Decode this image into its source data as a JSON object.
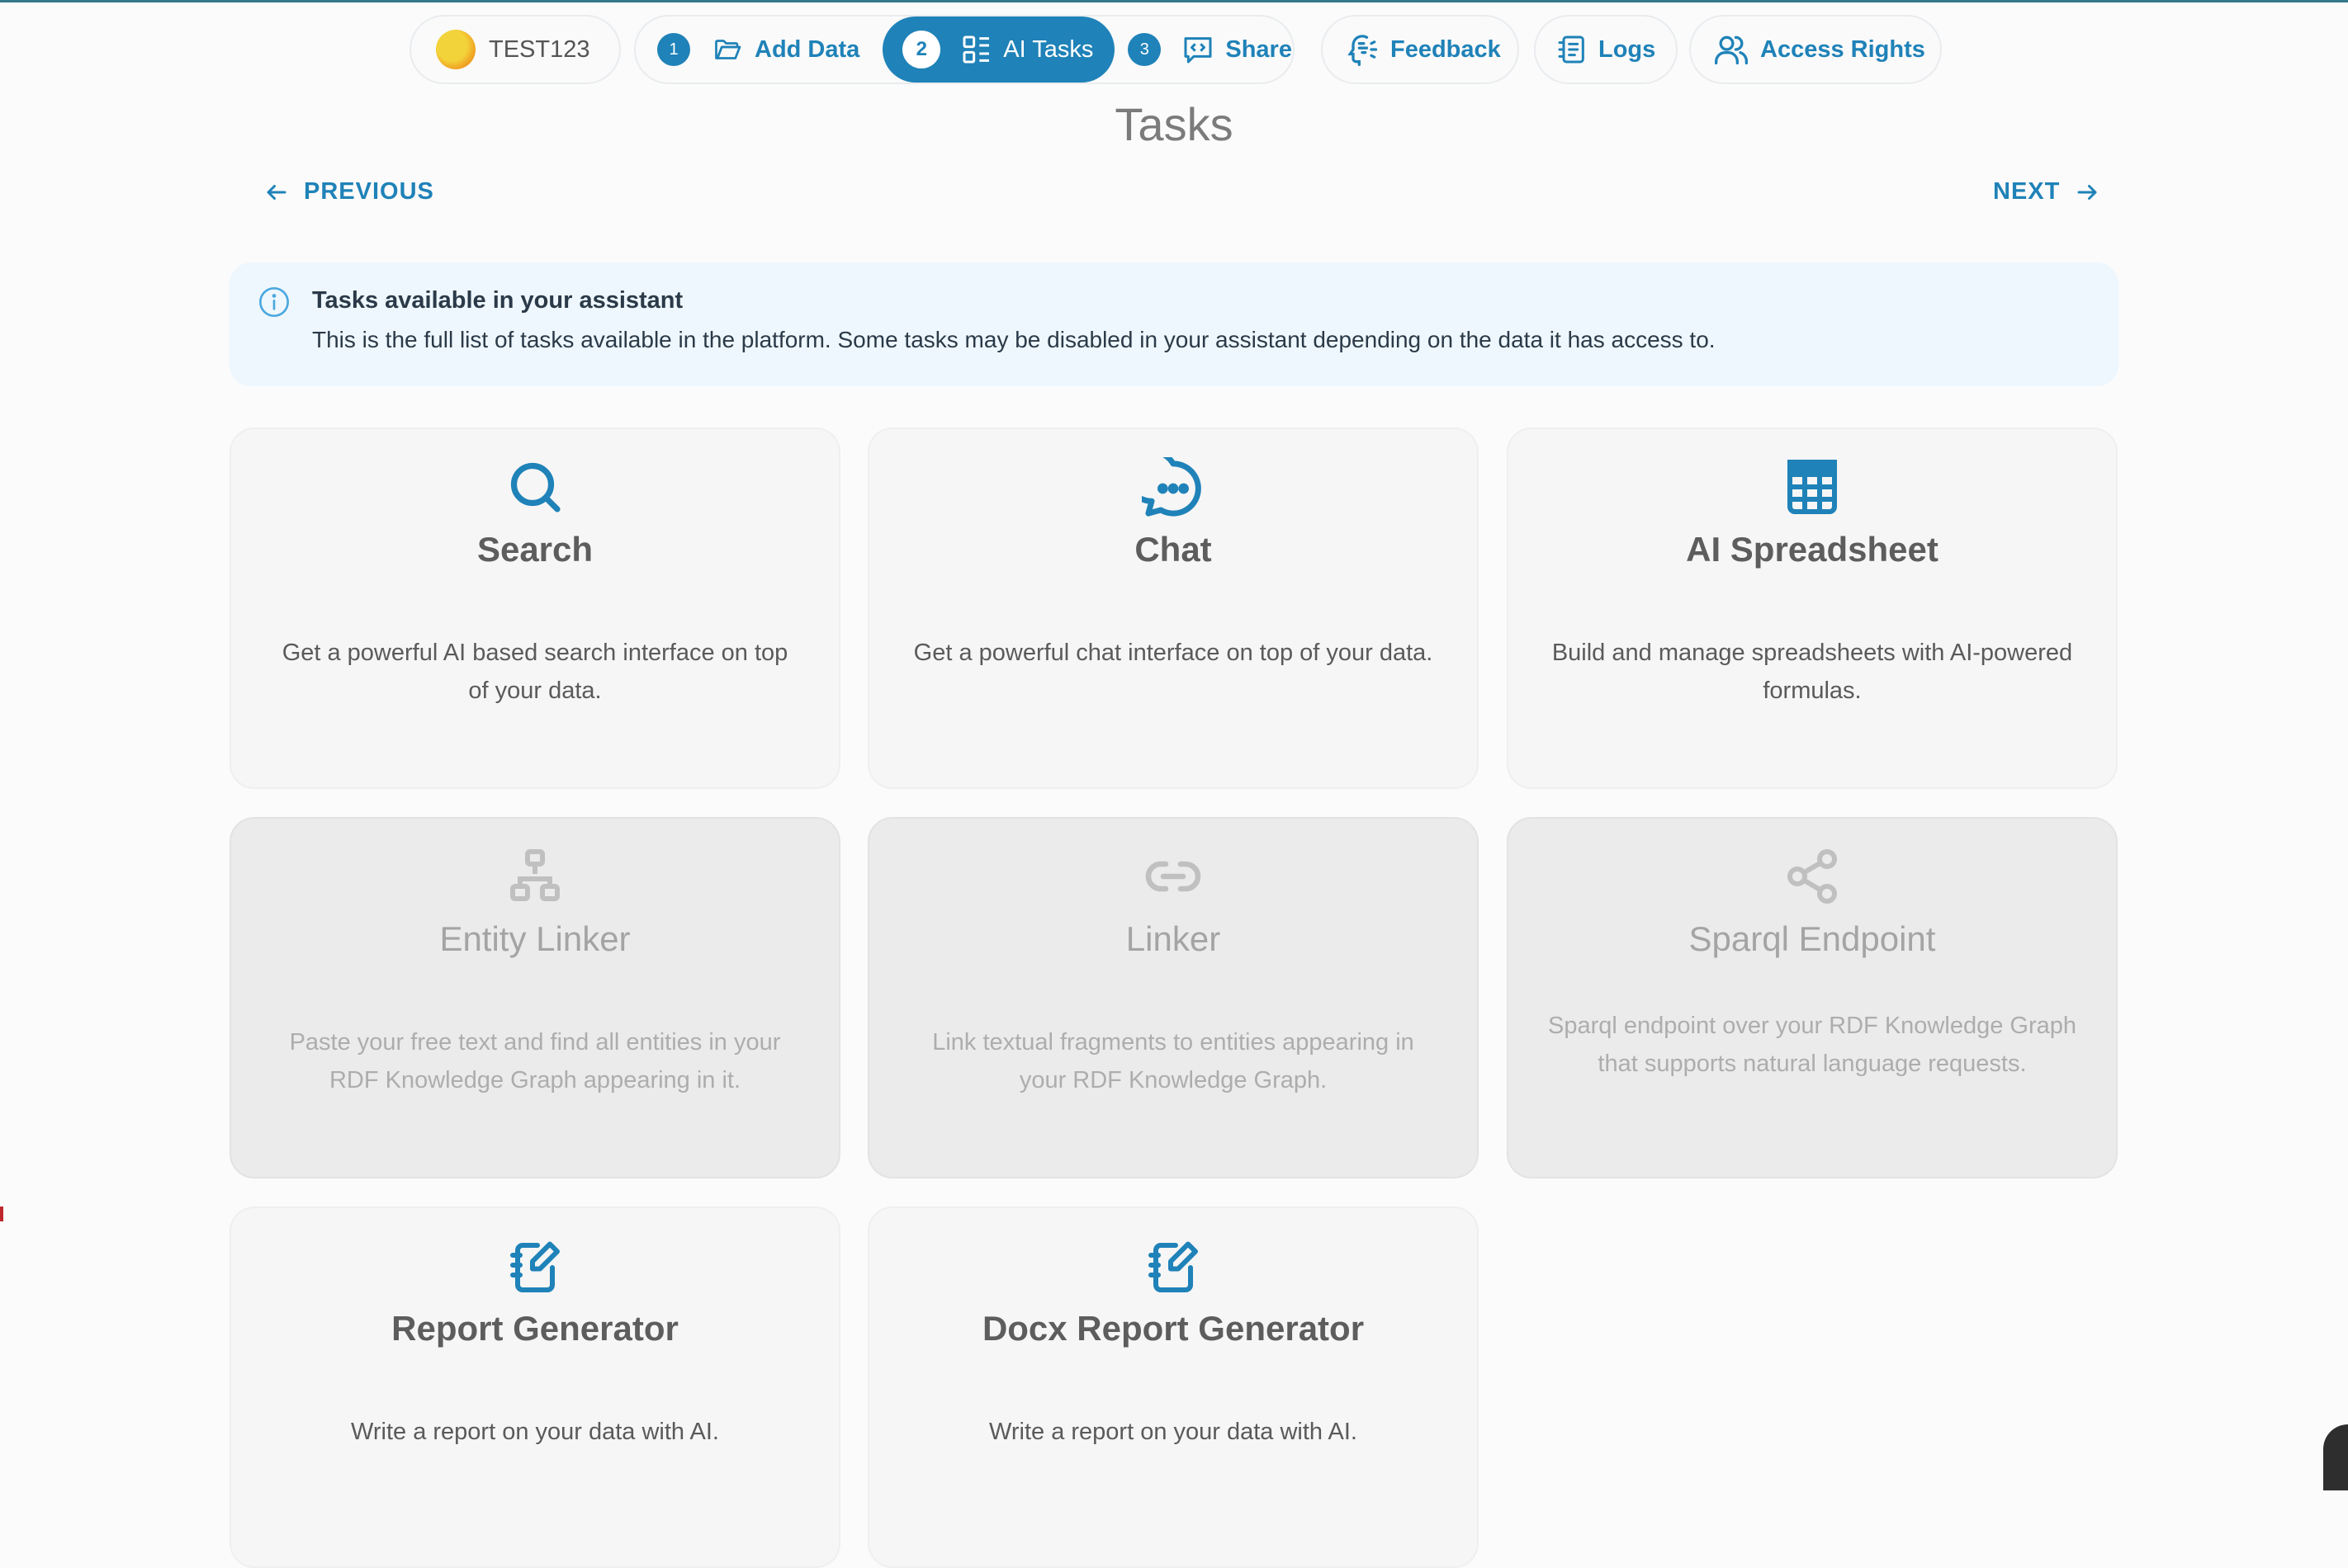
{
  "project": {
    "name": "TEST123"
  },
  "steps": [
    {
      "num": "1",
      "label": "Add Data"
    },
    {
      "num": "2",
      "label": "AI Tasks"
    },
    {
      "num": "3",
      "label": "Share"
    }
  ],
  "topbar": {
    "feedback": "Feedback",
    "logs": "Logs",
    "access": "Access Rights"
  },
  "page": {
    "title": "Tasks",
    "previous": "PREVIOUS",
    "next": "NEXT"
  },
  "alert": {
    "title": "Tasks available in your assistant",
    "text": "This is the full list of tasks available in the platform. Some tasks may be disabled in your assistant depending on the data it has access to."
  },
  "cards": [
    {
      "title": "Search",
      "icon": "search-icon",
      "desc": "Get a powerful AI based search interface on top of your data.",
      "enabled": true
    },
    {
      "title": "Chat",
      "icon": "chat-icon",
      "desc": "Get a powerful chat interface on top of your data.",
      "enabled": true
    },
    {
      "title": "AI Spreadsheet",
      "icon": "spreadsheet-icon",
      "desc": "Build and manage spreadsheets with AI-powered formulas.",
      "enabled": true
    },
    {
      "title": "Entity Linker",
      "icon": "hierarchy-icon",
      "desc": "Paste your free text and find all entities in your RDF Knowledge Graph appearing in it.",
      "enabled": false
    },
    {
      "title": "Linker",
      "icon": "link-icon",
      "desc": "Link textual fragments to entities appearing in your RDF Knowledge Graph.",
      "enabled": false
    },
    {
      "title": "Sparql Endpoint",
      "icon": "share-nodes-icon",
      "desc": "Sparql endpoint over your RDF Knowledge Graph that supports natural language requests.",
      "enabled": false
    },
    {
      "title": "Report Generator",
      "icon": "notebook-edit-icon",
      "desc": "Write a report on your data with AI.",
      "enabled": true
    },
    {
      "title": "Docx Report Generator",
      "icon": "notebook-edit-icon",
      "desc": "Write a report on your data with AI.",
      "enabled": true
    }
  ],
  "colors": {
    "accent": "#1f82b8",
    "disabled": "#c0c0c0",
    "alert_bg": "#eef7fd"
  }
}
